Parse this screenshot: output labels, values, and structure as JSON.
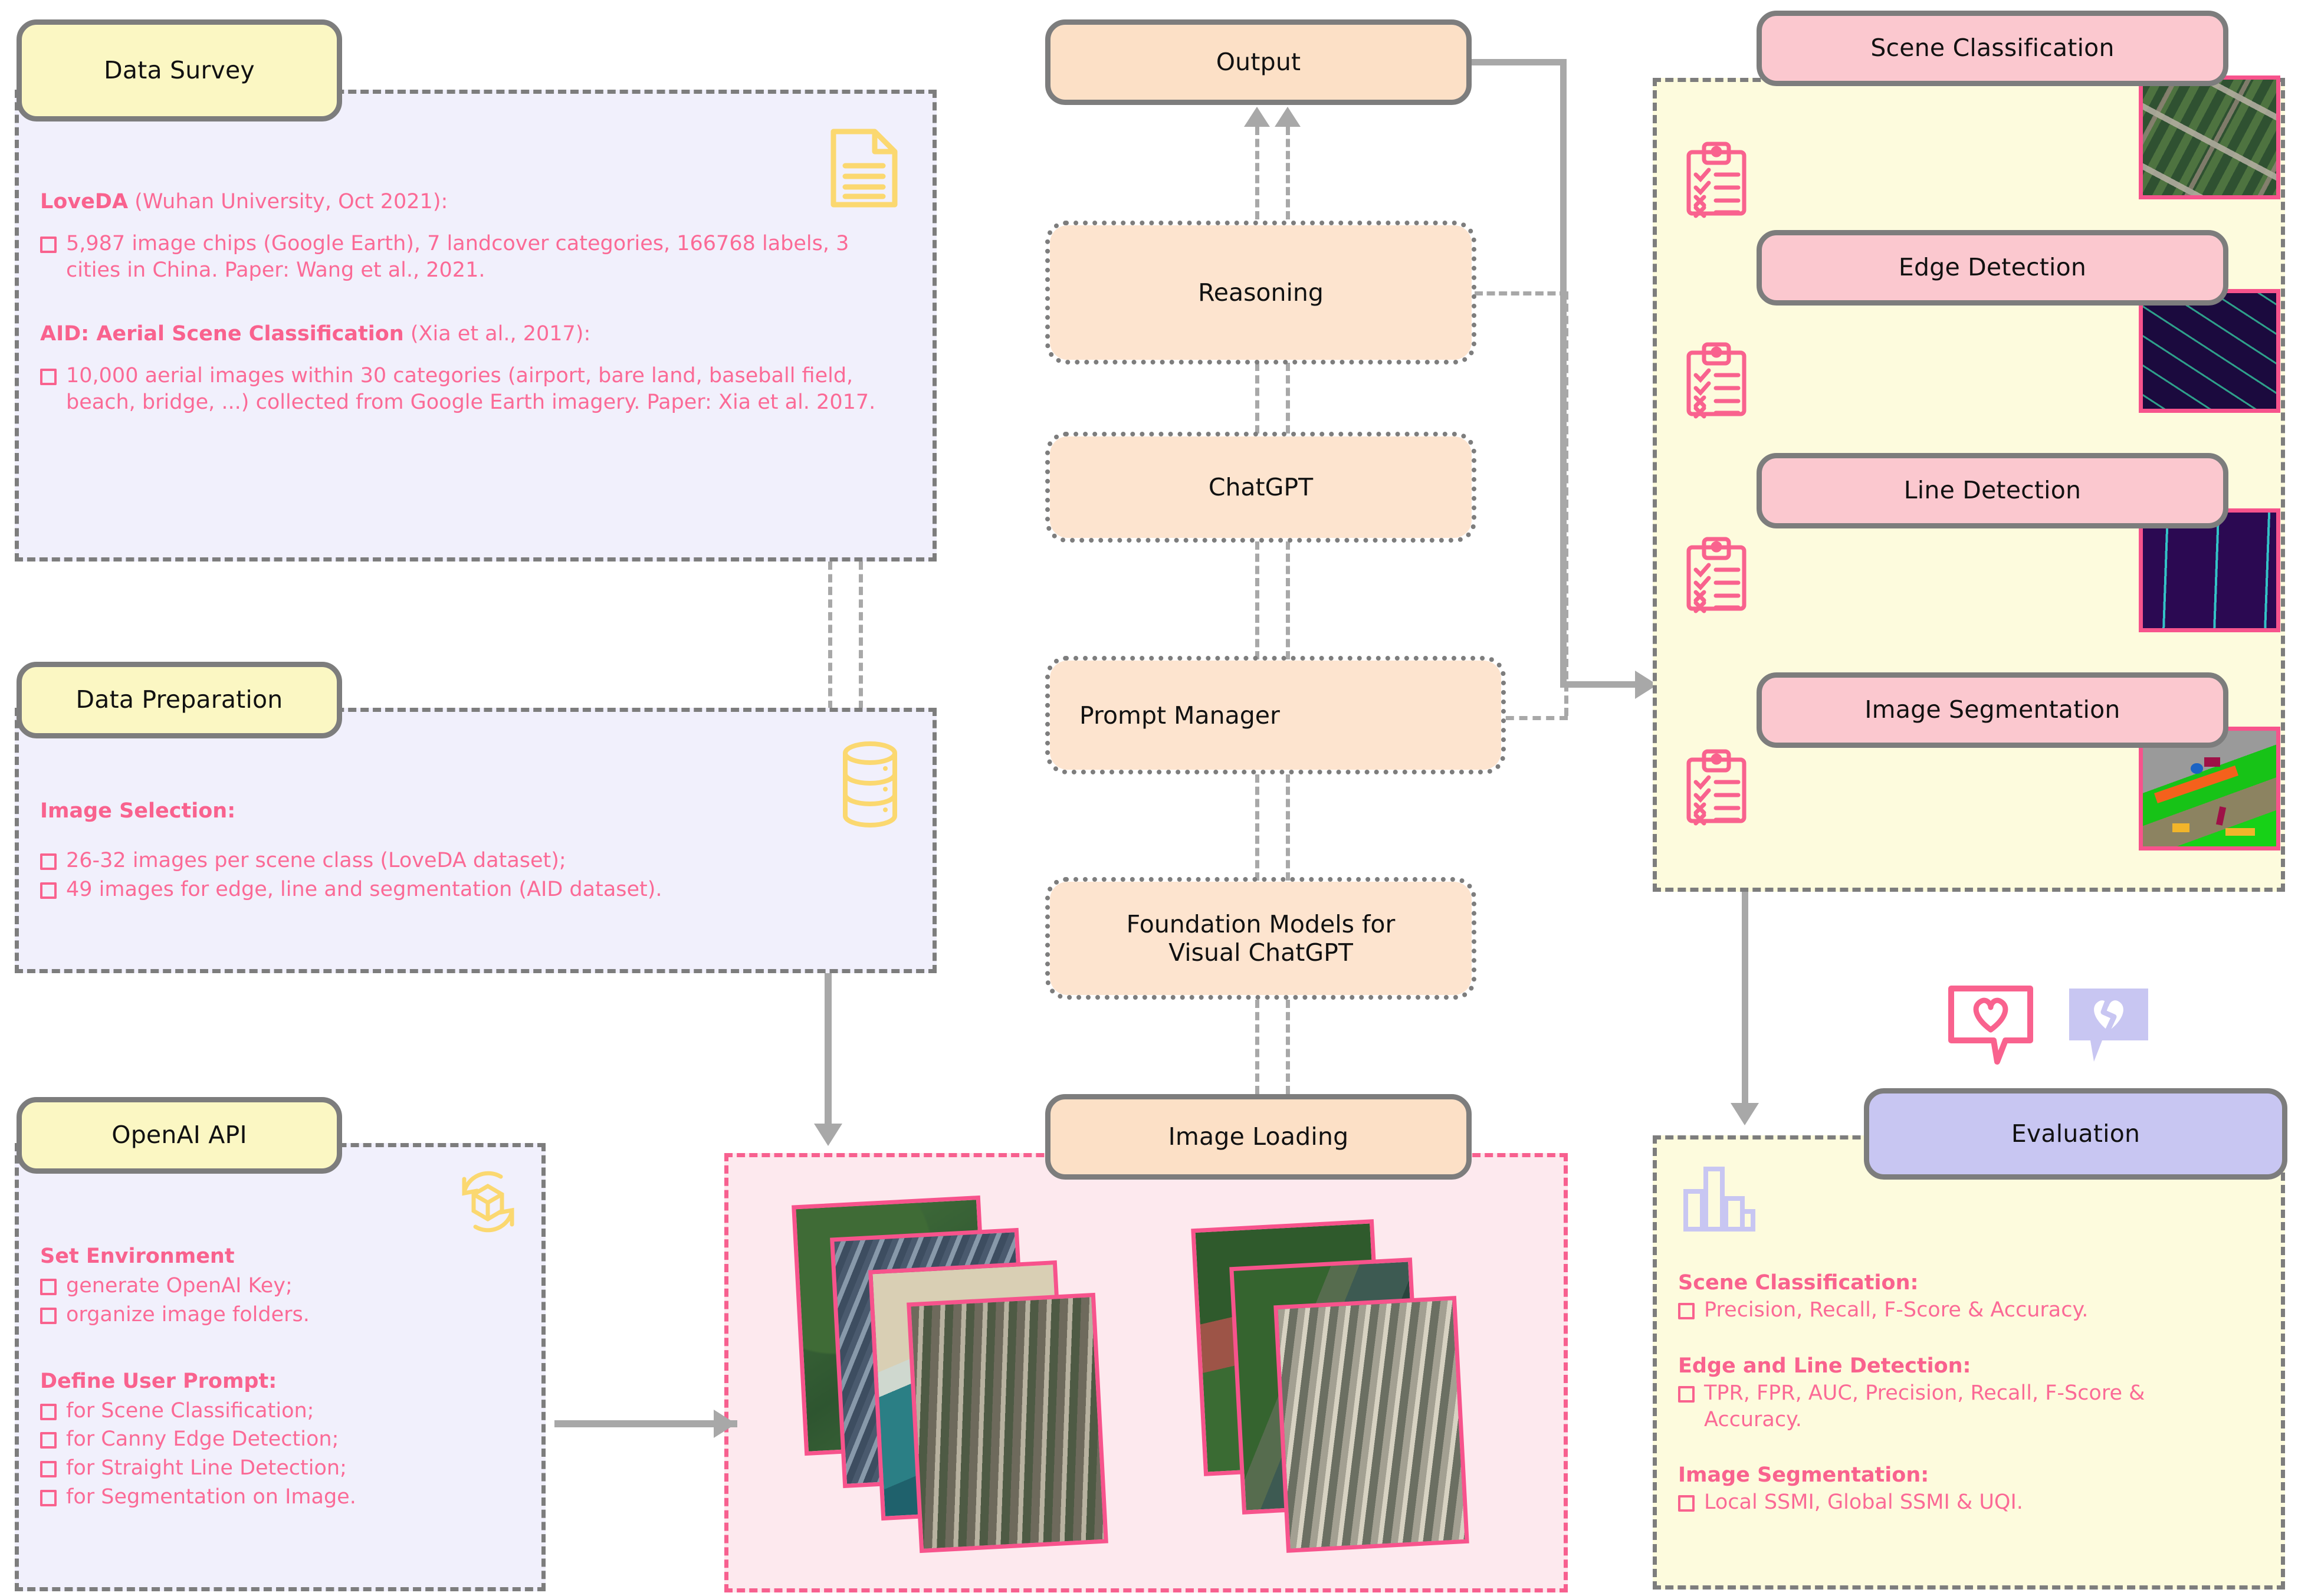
{
  "left_column": {
    "data_survey": {
      "title": "Data Survey",
      "icon": "document-icon",
      "entries": [
        {
          "heading_bold": "LoveDA",
          "heading_rest": " (Wuhan University, Oct 2021):",
          "bullets": [
            "5,987 image chips (Google Earth), 7 landcover categories, 166768 labels, 3 cities in China. Paper: Wang et al., 2021."
          ]
        },
        {
          "heading_bold": "AID: Aerial Scene Classification",
          "heading_rest": " (Xia et al., 2017):",
          "bullets": [
            "10,000 aerial images within 30 categories (airport, bare land, baseball field, beach, bridge, ...) collected from Google Earth imagery. Paper: Xia et al. 2017."
          ]
        }
      ]
    },
    "data_preparation": {
      "title": "Data Preparation",
      "icon": "database-icon",
      "heading": "Image Selection:",
      "bullets": [
        "26-32 images per scene class (LoveDA dataset);",
        "49 images for edge, line and segmentation (AID dataset)."
      ]
    },
    "openai_api": {
      "title": "OpenAI API",
      "icon": "package-refresh-icon",
      "groups": [
        {
          "heading": "Set Environment",
          "bullets": [
            "generate OpenAI Key;",
            "organize image folders."
          ]
        },
        {
          "heading": "Define User Prompt:",
          "bullets": [
            "for Scene Classification;",
            "for Canny Edge Detection;",
            "for Straight Line Detection;",
            "for Segmentation on Image."
          ]
        }
      ]
    }
  },
  "center_column": {
    "output": {
      "title": "Output",
      "icon": "export-arrow-icon"
    },
    "reasoning": {
      "title": "Reasoning",
      "icon": "brain-head-icon"
    },
    "chatgpt": {
      "title": "ChatGPT",
      "icon": "openai-logo-icon",
      "icon2": "gears-icon"
    },
    "prompt_manager": {
      "title": "Prompt Manager",
      "icon": "artist-icon"
    },
    "foundation_models": {
      "title": "Foundation Models for\nVisual ChatGPT",
      "line1": "Foundation Models for",
      "line2": "Visual ChatGPT"
    },
    "image_loading": {
      "title": "Image Loading",
      "icon": "import-arrow-icon"
    }
  },
  "right_column": {
    "tasks": [
      {
        "label": "Scene Classification",
        "icon": "checklist-icon",
        "thumb": "aerial-residential-thumb"
      },
      {
        "label": "Edge Detection",
        "icon": "checklist-icon",
        "thumb": "edge-map-thumb"
      },
      {
        "label": "Line Detection",
        "icon": "checklist-icon",
        "thumb": "line-map-thumb"
      },
      {
        "label": "Image Segmentation",
        "icon": "checklist-icon",
        "thumb": "segmentation-map-thumb"
      }
    ],
    "evaluation": {
      "title": "Evaluation",
      "icon": "bar-chart-icon",
      "badge_like": "heart-speech-bubble-icon",
      "badge_dislike": "broken-heart-speech-bubble-icon",
      "groups": [
        {
          "heading": "Scene Classification:",
          "bullets": [
            "Precision, Recall, F-Score & Accuracy."
          ]
        },
        {
          "heading": "Edge and Line Detection:",
          "bullets": [
            "TPR, FPR, AUC, Precision, Recall, F-Score & Accuracy."
          ]
        },
        {
          "heading": "Image Segmentation:",
          "bullets": [
            "Local SSMI, Global SSMI & UQI."
          ]
        }
      ]
    }
  },
  "colors": {
    "yellow_capsule": "#fbf7c3",
    "orange_capsule": "#fce0c6",
    "pink_capsule": "#fbc8cf",
    "purple_capsule": "#c8c6f2",
    "lavender_panel": "#f1f0fc",
    "yellow_panel": "#fdfbdd",
    "pink_panel": "#fde9ee",
    "accent_pink": "#f9628e",
    "accent_yellow": "#fbd870",
    "border_gray": "#7d7d7d",
    "line_gray": "#a8a8a8"
  }
}
